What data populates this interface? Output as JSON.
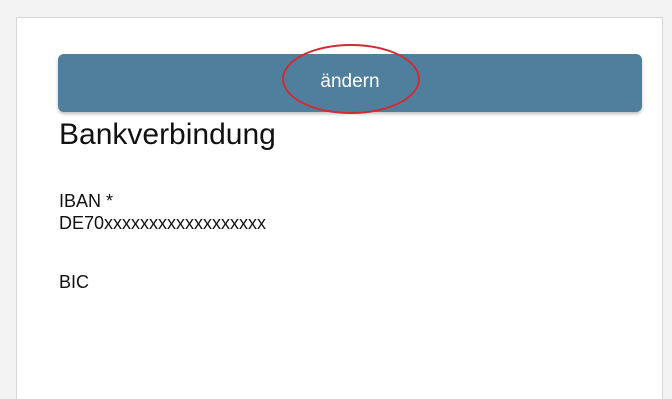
{
  "bank_section": {
    "edit_button_label": "ändern",
    "title": "Bankverbindung",
    "fields": {
      "iban_label": "IBAN *",
      "iban_value": "DE70xxxxxxxxxxxxxxxxxx",
      "bic_label": "BIC"
    }
  },
  "colors": {
    "button_background": "#4f7f9d",
    "highlight_ring": "#d12b34",
    "card_background": "#ffffff",
    "page_background": "#f3f3f3"
  }
}
